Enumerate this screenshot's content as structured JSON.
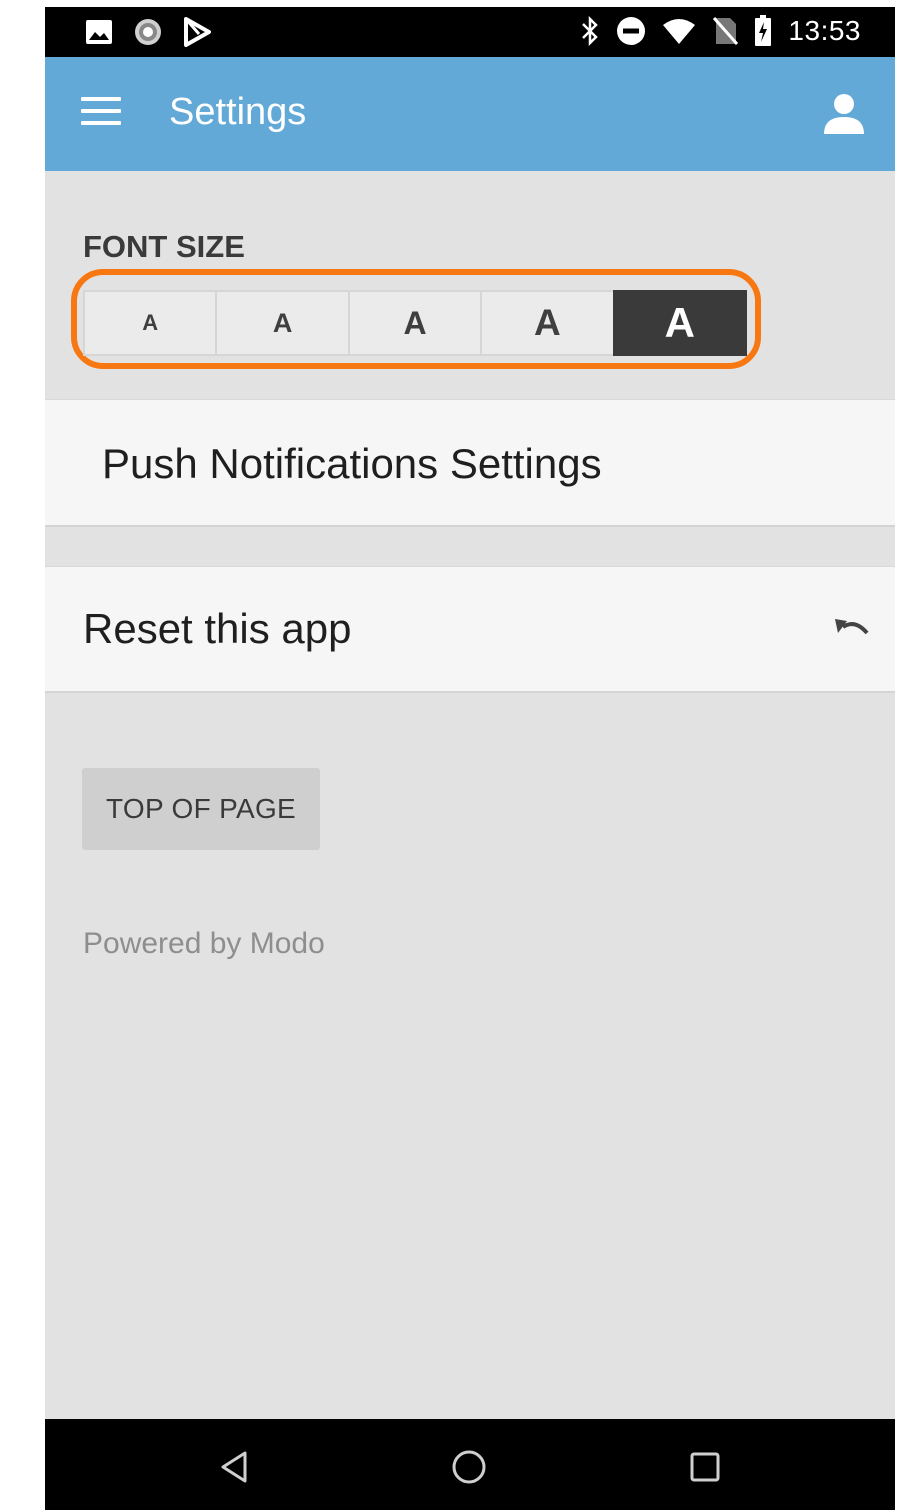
{
  "status_bar": {
    "time": "13:53",
    "left_icons": [
      "image-icon",
      "sync-icon",
      "play-store-icon"
    ],
    "right_icons": [
      "bluetooth-icon",
      "do-not-disturb-icon",
      "wifi-icon",
      "no-sim-icon",
      "battery-charging-icon"
    ]
  },
  "app_bar": {
    "title": "Settings",
    "menu_icon": "hamburger-menu-icon",
    "user_icon": "person-icon",
    "color": "#62a9d7"
  },
  "font_size": {
    "label": "FONT SIZE",
    "options": [
      "A",
      "A",
      "A",
      "A",
      "A"
    ],
    "selected_index": 4,
    "highlight_color": "#f77812"
  },
  "push_notifications": {
    "label": "Push Notifications Settings"
  },
  "reset": {
    "label": "Reset this app",
    "icon": "undo-icon"
  },
  "top_of_page": {
    "label": "TOP OF PAGE"
  },
  "footer": {
    "powered_by": "Powered by Modo"
  },
  "nav_bar": {
    "icons": [
      "back-icon",
      "home-icon",
      "recents-icon"
    ]
  }
}
